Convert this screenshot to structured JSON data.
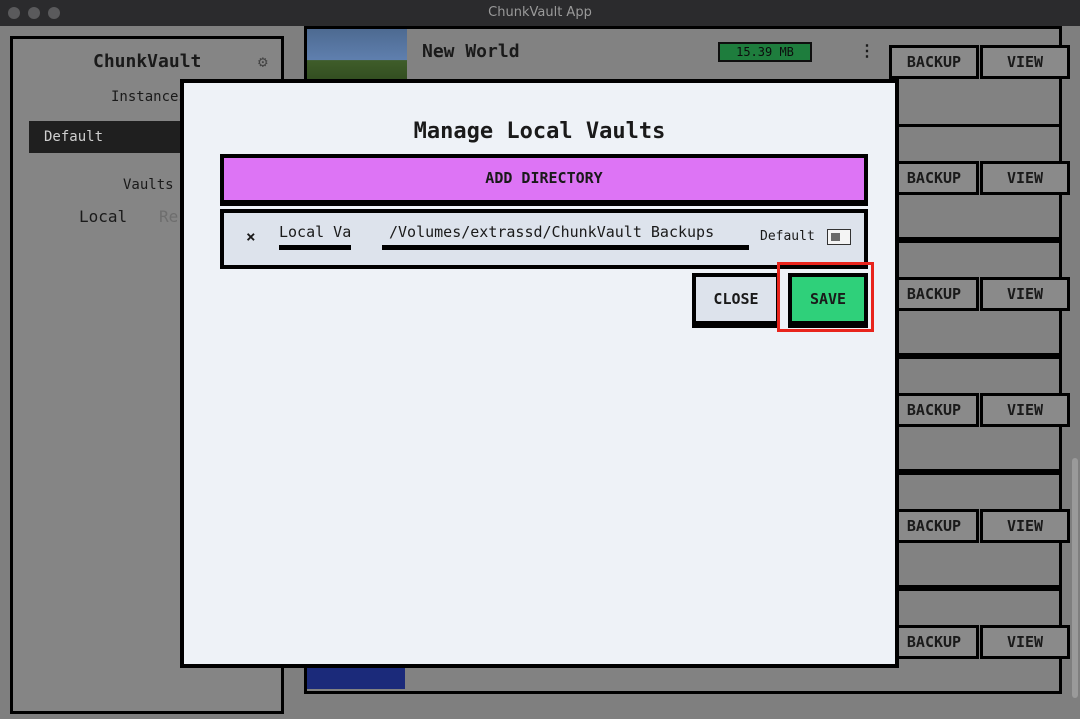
{
  "window": {
    "title": "ChunkVault App"
  },
  "sidebar": {
    "title": "ChunkVault",
    "instances_label": "Instances",
    "selected_instance": "Default",
    "vaults_label": "Vaults",
    "tabs": [
      "Local",
      "Re"
    ]
  },
  "worlds": [
    {
      "name": "New World",
      "size": "15.39 MB",
      "backup_label": "BACKUP",
      "view_label": "VIEW"
    },
    {
      "backup_label": "BACKUP",
      "view_label": "VIEW"
    },
    {
      "backup_label": "BACKUP",
      "view_label": "VIEW"
    },
    {
      "backup_label": "BACKUP",
      "view_label": "VIEW"
    },
    {
      "backup_label": "BACKUP",
      "view_label": "VIEW"
    },
    {
      "backup_label": "BACKUP",
      "view_label": "VIEW"
    }
  ],
  "modal": {
    "title": "Manage Local Vaults",
    "add_directory_label": "ADD DIRECTORY",
    "vault": {
      "remove_glyph": "×",
      "name": "Local Vaul",
      "path": "/Volumes/extrassd/ChunkVault Backups",
      "default_label": "Default",
      "default_checked": false
    },
    "close_label": "CLOSE",
    "save_label": "SAVE"
  },
  "colors": {
    "add_directory_bg": "#dd74f5",
    "save_bg": "#2fd07a",
    "size_badge_bg": "#1e7d3d",
    "highlight_border": "#e8241c"
  }
}
